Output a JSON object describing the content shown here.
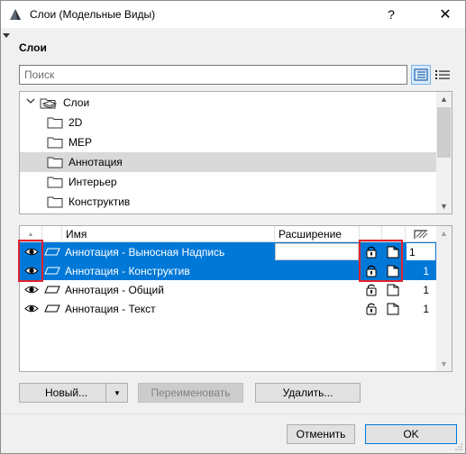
{
  "window": {
    "title": "Слои (Модельные Виды)",
    "help_label": "?",
    "close_label": "✕"
  },
  "section": {
    "title": "Слои"
  },
  "search": {
    "placeholder": "Поиск",
    "value": ""
  },
  "tree": {
    "root_label": "Слои",
    "items": [
      {
        "label": "2D",
        "selected": false
      },
      {
        "label": "MEP",
        "selected": false
      },
      {
        "label": "Аннотация",
        "selected": true
      },
      {
        "label": "Интерьер",
        "selected": false
      },
      {
        "label": "Конструктив",
        "selected": false
      }
    ],
    "scroll_up": "▲",
    "scroll_down": "▼"
  },
  "grid": {
    "columns": {
      "name": "Имя",
      "extension": "Расширение"
    },
    "sort_glyph": "▲",
    "rows": [
      {
        "name": "Аннотация - Выносная Надпись",
        "pen": "1",
        "selected": true
      },
      {
        "name": "Аннотация - Конструктив",
        "pen": "1",
        "selected": true
      },
      {
        "name": "Аннотация - Общий",
        "pen": "1",
        "selected": false
      },
      {
        "name": "Аннотация - Текст",
        "pen": "1",
        "selected": false
      }
    ],
    "scroll_up": "▲",
    "scroll_down": "▼"
  },
  "buttons": {
    "new": "Новый...",
    "new_arrow": "▼",
    "rename": "Переименовать",
    "delete": "Удалить...",
    "cancel": "Отменить",
    "ok": "OK"
  },
  "colors": {
    "selection": "#0078d7",
    "tree_selection": "#d9d9d9",
    "highlight": "#e0232e"
  }
}
